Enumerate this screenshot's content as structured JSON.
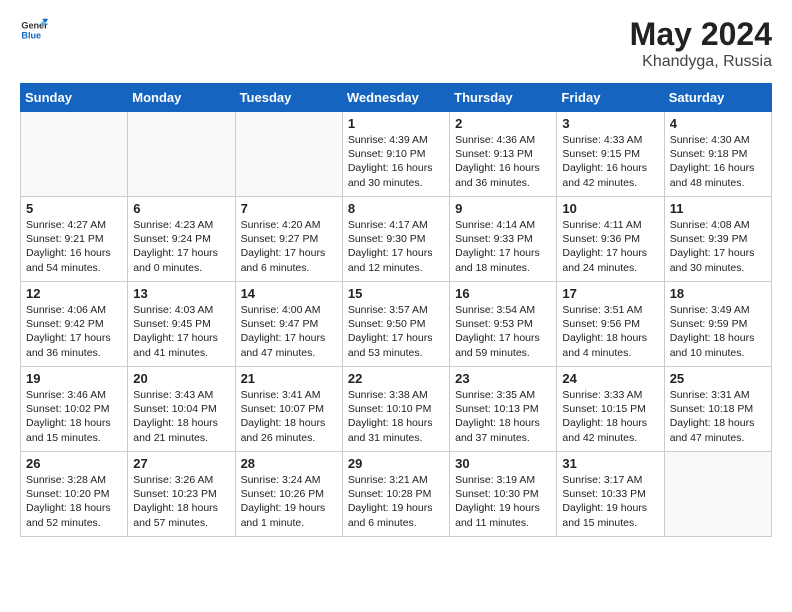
{
  "header": {
    "logo_general": "General",
    "logo_blue": "Blue",
    "title": "May 2024",
    "location": "Khandyga, Russia"
  },
  "days_of_week": [
    "Sunday",
    "Monday",
    "Tuesday",
    "Wednesday",
    "Thursday",
    "Friday",
    "Saturday"
  ],
  "weeks": [
    [
      {
        "day": "",
        "info": ""
      },
      {
        "day": "",
        "info": ""
      },
      {
        "day": "",
        "info": ""
      },
      {
        "day": "1",
        "info": "Sunrise: 4:39 AM\nSunset: 9:10 PM\nDaylight: 16 hours\nand 30 minutes."
      },
      {
        "day": "2",
        "info": "Sunrise: 4:36 AM\nSunset: 9:13 PM\nDaylight: 16 hours\nand 36 minutes."
      },
      {
        "day": "3",
        "info": "Sunrise: 4:33 AM\nSunset: 9:15 PM\nDaylight: 16 hours\nand 42 minutes."
      },
      {
        "day": "4",
        "info": "Sunrise: 4:30 AM\nSunset: 9:18 PM\nDaylight: 16 hours\nand 48 minutes."
      }
    ],
    [
      {
        "day": "5",
        "info": "Sunrise: 4:27 AM\nSunset: 9:21 PM\nDaylight: 16 hours\nand 54 minutes."
      },
      {
        "day": "6",
        "info": "Sunrise: 4:23 AM\nSunset: 9:24 PM\nDaylight: 17 hours\nand 0 minutes."
      },
      {
        "day": "7",
        "info": "Sunrise: 4:20 AM\nSunset: 9:27 PM\nDaylight: 17 hours\nand 6 minutes."
      },
      {
        "day": "8",
        "info": "Sunrise: 4:17 AM\nSunset: 9:30 PM\nDaylight: 17 hours\nand 12 minutes."
      },
      {
        "day": "9",
        "info": "Sunrise: 4:14 AM\nSunset: 9:33 PM\nDaylight: 17 hours\nand 18 minutes."
      },
      {
        "day": "10",
        "info": "Sunrise: 4:11 AM\nSunset: 9:36 PM\nDaylight: 17 hours\nand 24 minutes."
      },
      {
        "day": "11",
        "info": "Sunrise: 4:08 AM\nSunset: 9:39 PM\nDaylight: 17 hours\nand 30 minutes."
      }
    ],
    [
      {
        "day": "12",
        "info": "Sunrise: 4:06 AM\nSunset: 9:42 PM\nDaylight: 17 hours\nand 36 minutes."
      },
      {
        "day": "13",
        "info": "Sunrise: 4:03 AM\nSunset: 9:45 PM\nDaylight: 17 hours\nand 41 minutes."
      },
      {
        "day": "14",
        "info": "Sunrise: 4:00 AM\nSunset: 9:47 PM\nDaylight: 17 hours\nand 47 minutes."
      },
      {
        "day": "15",
        "info": "Sunrise: 3:57 AM\nSunset: 9:50 PM\nDaylight: 17 hours\nand 53 minutes."
      },
      {
        "day": "16",
        "info": "Sunrise: 3:54 AM\nSunset: 9:53 PM\nDaylight: 17 hours\nand 59 minutes."
      },
      {
        "day": "17",
        "info": "Sunrise: 3:51 AM\nSunset: 9:56 PM\nDaylight: 18 hours\nand 4 minutes."
      },
      {
        "day": "18",
        "info": "Sunrise: 3:49 AM\nSunset: 9:59 PM\nDaylight: 18 hours\nand 10 minutes."
      }
    ],
    [
      {
        "day": "19",
        "info": "Sunrise: 3:46 AM\nSunset: 10:02 PM\nDaylight: 18 hours\nand 15 minutes."
      },
      {
        "day": "20",
        "info": "Sunrise: 3:43 AM\nSunset: 10:04 PM\nDaylight: 18 hours\nand 21 minutes."
      },
      {
        "day": "21",
        "info": "Sunrise: 3:41 AM\nSunset: 10:07 PM\nDaylight: 18 hours\nand 26 minutes."
      },
      {
        "day": "22",
        "info": "Sunrise: 3:38 AM\nSunset: 10:10 PM\nDaylight: 18 hours\nand 31 minutes."
      },
      {
        "day": "23",
        "info": "Sunrise: 3:35 AM\nSunset: 10:13 PM\nDaylight: 18 hours\nand 37 minutes."
      },
      {
        "day": "24",
        "info": "Sunrise: 3:33 AM\nSunset: 10:15 PM\nDaylight: 18 hours\nand 42 minutes."
      },
      {
        "day": "25",
        "info": "Sunrise: 3:31 AM\nSunset: 10:18 PM\nDaylight: 18 hours\nand 47 minutes."
      }
    ],
    [
      {
        "day": "26",
        "info": "Sunrise: 3:28 AM\nSunset: 10:20 PM\nDaylight: 18 hours\nand 52 minutes."
      },
      {
        "day": "27",
        "info": "Sunrise: 3:26 AM\nSunset: 10:23 PM\nDaylight: 18 hours\nand 57 minutes."
      },
      {
        "day": "28",
        "info": "Sunrise: 3:24 AM\nSunset: 10:26 PM\nDaylight: 19 hours\nand 1 minute."
      },
      {
        "day": "29",
        "info": "Sunrise: 3:21 AM\nSunset: 10:28 PM\nDaylight: 19 hours\nand 6 minutes."
      },
      {
        "day": "30",
        "info": "Sunrise: 3:19 AM\nSunset: 10:30 PM\nDaylight: 19 hours\nand 11 minutes."
      },
      {
        "day": "31",
        "info": "Sunrise: 3:17 AM\nSunset: 10:33 PM\nDaylight: 19 hours\nand 15 minutes."
      },
      {
        "day": "",
        "info": ""
      }
    ]
  ]
}
